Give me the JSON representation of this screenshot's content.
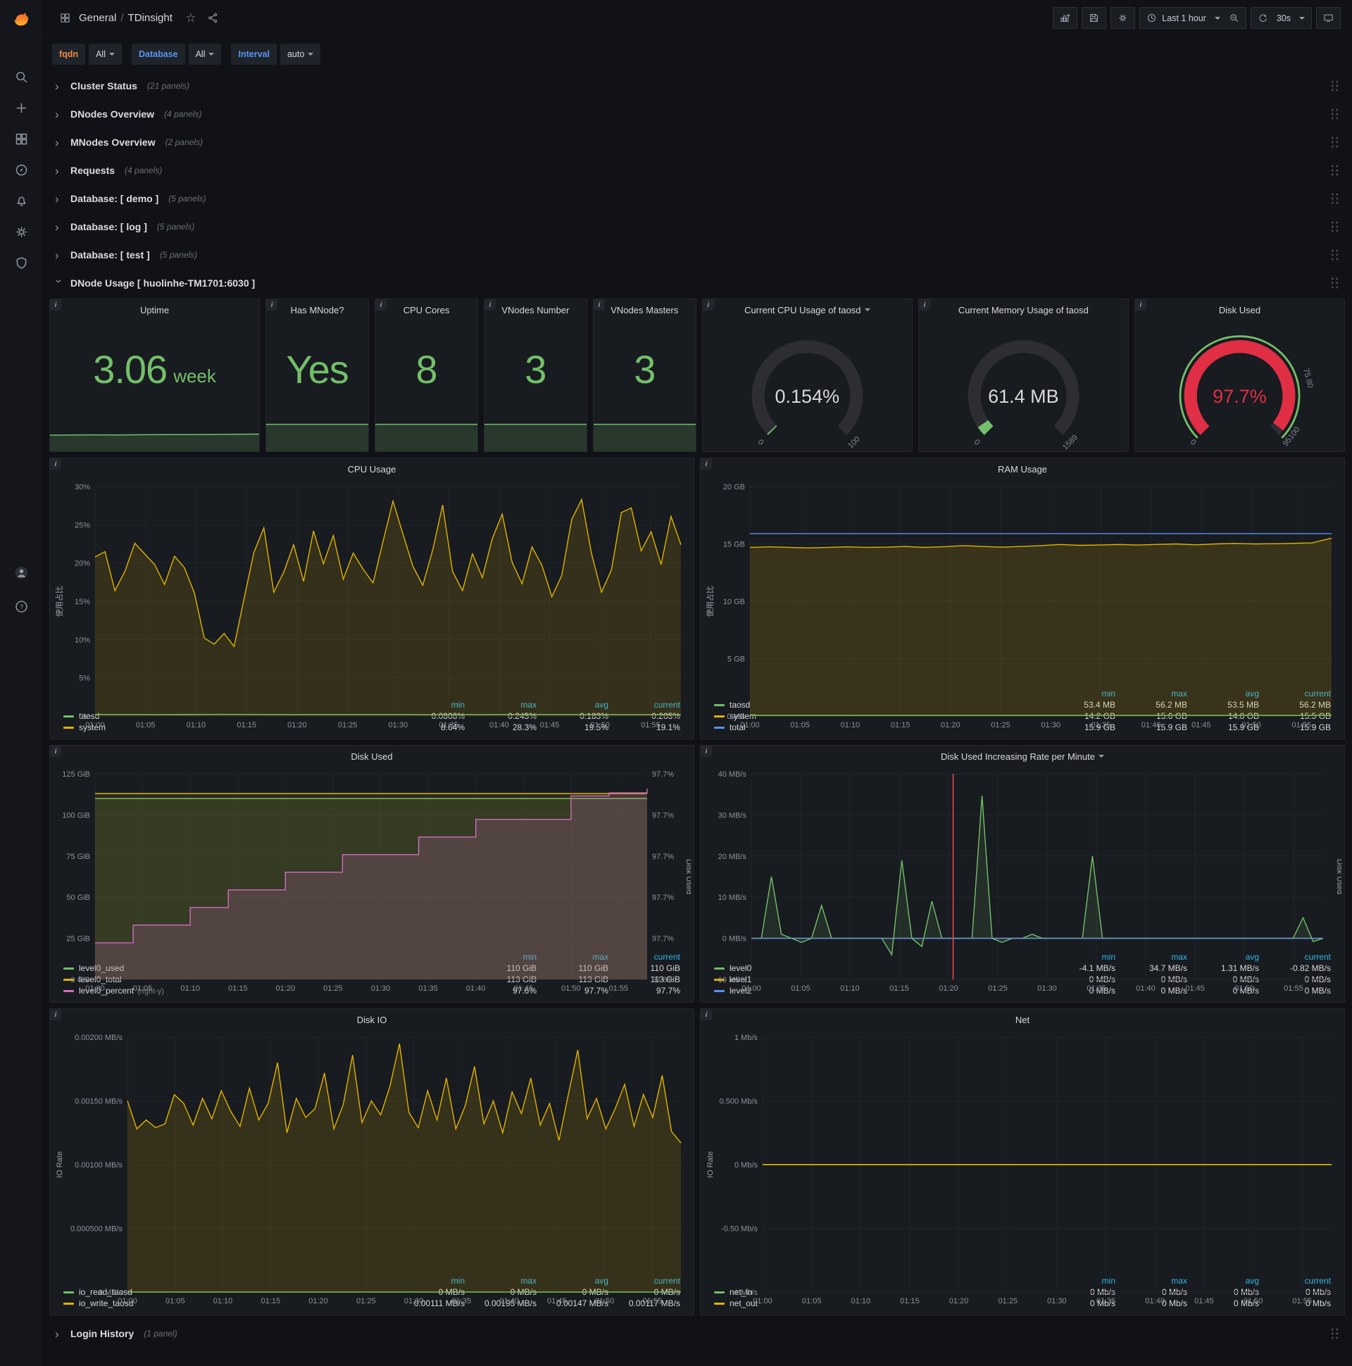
{
  "misc": {
    "info_i": "i",
    "star": "☆"
  },
  "colors": {
    "green": "#73bf69",
    "yellow": "#e0b400",
    "blue": "#5794f2",
    "pink": "#d16dc1",
    "red": "#e02f44",
    "annotation": "#f2495c"
  },
  "navbar": {
    "breadcrumb": {
      "section": "General",
      "separator": "/",
      "page": "TDinsight"
    },
    "time_range_label": "Last 1 hour",
    "refresh_value": "30s"
  },
  "variables": [
    {
      "label": "fqdn",
      "label_color": "#eb8b47",
      "value": "All"
    },
    {
      "label": "Database",
      "label_color": "#5794f2",
      "value": "All"
    },
    {
      "label": "Interval",
      "label_color": "#5794f2",
      "value": "auto"
    }
  ],
  "rows_top": [
    {
      "title": "Cluster Status",
      "count": "(21 panels)"
    },
    {
      "title": "DNodes Overview",
      "count": "(4 panels)"
    },
    {
      "title": "MNodes Overview",
      "count": "(2 panels)"
    },
    {
      "title": "Requests",
      "count": "(4 panels)"
    },
    {
      "title": "Database: [ demo ]",
      "count": "(5 panels)"
    },
    {
      "title": "Database: [ log ]",
      "count": "(5 panels)"
    },
    {
      "title": "Database: [ test ]",
      "count": "(5 panels)"
    }
  ],
  "expanded_row_title": "DNode Usage [ huolinhe-TM1701:6030 ]",
  "rows_bottom": [
    {
      "title": "Login History",
      "count": "(1 panel)"
    }
  ],
  "stat_panels": [
    {
      "title": "Uptime",
      "value": "3.06",
      "suffix": "week",
      "spark": [
        2.88,
        2.9,
        2.93,
        2.9,
        2.95,
        2.98,
        2.97,
        3.0,
        3.03,
        3.06
      ],
      "spark_max": 6.0
    },
    {
      "title": "Has MNode?",
      "value": "Yes",
      "spark": [
        1,
        1
      ],
      "spark_max": 1.25
    },
    {
      "title": "CPU Cores",
      "value": "8",
      "spark": [
        8,
        8
      ],
      "spark_max": 10
    },
    {
      "title": "VNodes Number",
      "value": "3",
      "spark": [
        3,
        3
      ],
      "spark_max": 3.75
    },
    {
      "title": "VNodes Masters",
      "value": "3",
      "spark": [
        3,
        3
      ],
      "spark_max": 3.75
    }
  ],
  "gauge_panels": [
    {
      "title": "Current CPU Usage of taosd",
      "has_caret": true,
      "value": "0.154%",
      "pct": 0.154,
      "value_color": "#d8d9da",
      "arc_color": "green",
      "ticks": [
        {
          "t": "0",
          "f": 0
        },
        {
          "t": "100",
          "f": 1
        }
      ]
    },
    {
      "title": "Current Memory Usage of taosd",
      "value": "61.4 MB",
      "pct": 3.86,
      "value_color": "#d8d9da",
      "arc_color": "green",
      "ticks": [
        {
          "t": "0",
          "f": 0
        },
        {
          "t": "1589",
          "f": 1
        }
      ]
    },
    {
      "title": "Disk Used",
      "value": "97.7%",
      "pct": 97.7,
      "value_color": "#e02f44",
      "arc_color": "red",
      "outer_ring": "#73bf69",
      "ticks": [
        {
          "t": "0",
          "f": 0
        },
        {
          "t": "75.80",
          "f": 0.78
        },
        {
          "t": "95100",
          "f": 0.975
        }
      ]
    }
  ],
  "time_ticks": [
    "01:00",
    "01:05",
    "01:10",
    "01:15",
    "01:20",
    "01:25",
    "01:30",
    "01:35",
    "01:40",
    "01:45",
    "01:50",
    "01:55"
  ],
  "charts": {
    "cpu": {
      "title": "CPU Usage",
      "type": "line",
      "ylabel": "使用占比",
      "mleft": 40,
      "yticks": [
        "30%",
        "25%",
        "20%",
        "15%",
        "10%",
        "5%",
        "0%"
      ],
      "ylim": [
        0,
        30
      ],
      "legend_cols": [
        "min",
        "max",
        "avg",
        "current"
      ],
      "series": [
        {
          "name": "taosd",
          "color": "green",
          "fill": 0.05,
          "points": [
            0.21,
            0.2,
            0.22,
            0.2,
            0.21,
            0.2,
            0.2,
            0.21,
            0.2,
            0.2
          ],
          "legend": [
            "0.0808%",
            "0.245%",
            "0.183%",
            "0.205%"
          ]
        },
        {
          "name": "system",
          "color": "yellow",
          "fill": 0.14,
          "points": [
            20.8,
            21.5,
            16.4,
            18.9,
            22.6,
            21.2,
            19.8,
            17.2,
            20.9,
            19.4,
            16.1,
            10.2,
            9.4,
            10.8,
            9.1,
            15.3,
            21.4,
            24.6,
            16.2,
            18.8,
            22.4,
            17.6,
            24.2,
            19.9,
            23.6,
            17.9,
            21.3,
            19.2,
            17.4,
            22.8,
            28.1,
            23.8,
            19.6,
            17.1,
            21.7,
            27.6,
            18.9,
            16.4,
            21.2,
            18.1,
            23.2,
            26.4,
            20.1,
            17.3,
            22.1,
            19.7,
            15.6,
            18.4,
            25.7,
            28.3,
            21.2,
            16.2,
            19.1,
            26.6,
            27.2,
            21.6,
            24.1,
            19.8,
            26.1,
            22.4
          ],
          "legend": [
            "8.64%",
            "28.3%",
            "19.5%",
            "19.1%"
          ]
        }
      ]
    },
    "ram": {
      "title": "RAM Usage",
      "type": "line",
      "ylabel": "使用占比",
      "mleft": 46,
      "yticks": [
        "20 GB",
        "15 GB",
        "10 GB",
        "5 GB",
        "0 MB"
      ],
      "ylim": [
        0,
        20
      ],
      "legend_cols": [
        "min",
        "max",
        "avg",
        "current"
      ],
      "series": [
        {
          "name": "taosd",
          "color": "green",
          "fill": 0.05,
          "points": [
            0.06,
            0.06
          ],
          "legend": [
            "53.4 MB",
            "56.2 MB",
            "53.5 MB",
            "56.2 MB"
          ]
        },
        {
          "name": "system",
          "color": "yellow",
          "fill": 0.16,
          "points": [
            14.7,
            14.75,
            14.7,
            14.65,
            14.7,
            14.75,
            14.7,
            14.72,
            14.78,
            14.7,
            14.76,
            14.85,
            14.78,
            14.72,
            14.78,
            14.85,
            14.95,
            14.88,
            14.9,
            14.95,
            14.9,
            14.96,
            15.0,
            14.92,
            15.0,
            15.05,
            15.0,
            15.02,
            15.05,
            15.1,
            15.5
          ],
          "legend": [
            "14.2 GB",
            "15.6 GB",
            "14.8 GB",
            "15.5 GB"
          ]
        },
        {
          "name": "total",
          "color": "blue",
          "fill": 0,
          "points": [
            15.9,
            15.9
          ],
          "legend": [
            "15.9 GB",
            "15.9 GB",
            "15.9 GB",
            "15.9 GB"
          ]
        }
      ]
    },
    "disk_used": {
      "title": "Disk Used",
      "type": "line",
      "mleft": 52,
      "mright": 62,
      "y2label": "Disk Used",
      "yticks": [
        "125 GiB",
        "100 GiB",
        "75 GiB",
        "50 GiB",
        "25 GiB",
        "0 GiB"
      ],
      "ylim": [
        0,
        125
      ],
      "y2ticks": [
        "97.7%",
        "97.7%",
        "97.7%",
        "97.7%",
        "97.7%",
        "97.6%"
      ],
      "ylim2": [
        97.575,
        97.715
      ],
      "legend_cols": [
        "min",
        "max",
        "current"
      ],
      "series": [
        {
          "name": "level0_used",
          "color": "green",
          "fill": 0.12,
          "points": [
            110,
            110
          ],
          "legend": [
            "110 GiB",
            "110 GiB",
            "110 GiB"
          ]
        },
        {
          "name": "level0_total",
          "color": "yellow",
          "fill": 0.1,
          "points": [
            113,
            113
          ],
          "legend": [
            "113 GiB",
            "113 GiB",
            "113 GiB"
          ]
        },
        {
          "name": "level0_percent",
          "suffix": "(right-y)",
          "color": "pink",
          "fill": 0.18,
          "axis2": true,
          "step": true,
          "points": [
            97.6,
            97.6,
            97.612,
            97.612,
            97.612,
            97.624,
            97.624,
            97.636,
            97.636,
            97.636,
            97.648,
            97.648,
            97.648,
            97.66,
            97.66,
            97.66,
            97.66,
            97.672,
            97.672,
            97.672,
            97.684,
            97.684,
            97.684,
            97.684,
            97.684,
            97.7,
            97.7,
            97.702,
            97.702,
            97.705
          ],
          "legend": [
            "97.6%",
            "97.7%",
            "97.7%"
          ]
        }
      ]
    },
    "disk_rate": {
      "title": "Disk Used Increasing Rate per Minute",
      "type": "line",
      "has_caret": true,
      "mleft": 60,
      "mright": 26,
      "y2label": "Disk Used",
      "yticks": [
        "40 MB/s",
        "30 MB/s",
        "20 MB/s",
        "10 MB/s",
        "0 MB/s",
        "-10 MB/s"
      ],
      "ylim": [
        -10,
        40
      ],
      "legend_cols": [
        "min",
        "max",
        "avg",
        "current"
      ],
      "annotation": {
        "frac": 0.353,
        "color": "#f2495c"
      },
      "series": [
        {
          "name": "level0",
          "color": "green",
          "fill": 0.12,
          "points": [
            0,
            0,
            15,
            1,
            0,
            -1,
            0,
            8,
            0,
            0,
            0,
            0,
            0,
            0,
            -4,
            19,
            0,
            -2,
            9,
            0,
            0,
            0,
            0,
            34.7,
            0,
            -1,
            0,
            0,
            1,
            0,
            0,
            0,
            0,
            0,
            20,
            0,
            0,
            0,
            0,
            0,
            0,
            0,
            0,
            0,
            0,
            0,
            0,
            0,
            0,
            0,
            0,
            0,
            0,
            0,
            0,
            5,
            -0.8,
            0
          ],
          "legend": [
            "-4.1 MB/s",
            "34.7 MB/s",
            "1.31 MB/s",
            "-0.82 MB/s"
          ]
        },
        {
          "name": "level1",
          "color": "yellow",
          "fill": 0,
          "points": [
            0,
            0
          ],
          "legend": [
            "0 MB/s",
            "0 MB/s",
            "0 MB/s",
            "0 MB/s"
          ]
        },
        {
          "name": "level2",
          "color": "blue",
          "fill": 0,
          "points": [
            0,
            0
          ],
          "legend": [
            "0 MB/s",
            "0 MB/s",
            "0 MB/s",
            "0 MB/s"
          ]
        }
      ]
    },
    "disk_io": {
      "title": "Disk IO",
      "type": "line",
      "ylabel": "IO Rate",
      "mleft": 86,
      "yticks": [
        "0.00200 MB/s",
        "0.00150 MB/s",
        "0.00100 MB/s",
        "0.000500 MB/s",
        "0 MB/s"
      ],
      "ylim": [
        0,
        0.002
      ],
      "legend_cols": [
        "min",
        "max",
        "avg",
        "current"
      ],
      "series": [
        {
          "name": "io_read_taosd",
          "color": "green",
          "fill": 0,
          "points": [
            0,
            0
          ],
          "legend": [
            "0 MB/s",
            "0 MB/s",
            "0 MB/s",
            "0 MB/s"
          ]
        },
        {
          "name": "io_write_taosd",
          "color": "yellow",
          "fill": 0.15,
          "points": [
            0.0015,
            0.00128,
            0.00135,
            0.00129,
            0.00132,
            0.00155,
            0.00148,
            0.00131,
            0.00152,
            0.00136,
            0.00158,
            0.00142,
            0.0013,
            0.0016,
            0.00135,
            0.00148,
            0.0018,
            0.00125,
            0.00152,
            0.00137,
            0.00144,
            0.00172,
            0.00128,
            0.00147,
            0.00186,
            0.00133,
            0.0015,
            0.00139,
            0.00162,
            0.00195,
            0.00141,
            0.00129,
            0.00158,
            0.00135,
            0.00168,
            0.00128,
            0.00146,
            0.00177,
            0.00132,
            0.0015,
            0.00125,
            0.00157,
            0.0014,
            0.00168,
            0.00131,
            0.00148,
            0.00119,
            0.00155,
            0.0019,
            0.00136,
            0.00152,
            0.00128,
            0.00144,
            0.00163,
            0.0013,
            0.00155,
            0.00137,
            0.0017,
            0.00126,
            0.00117
          ],
          "legend": [
            "0.00111 MB/s",
            "0.00195 MB/s",
            "0.00147 MB/s",
            "0.00117 MB/s"
          ]
        }
      ]
    },
    "net": {
      "title": "Net",
      "type": "line",
      "ylabel": "IO Rate",
      "mleft": 64,
      "yticks": [
        "1 Mb/s",
        "0.500 Mb/s",
        "0 Mb/s",
        "-0.50 Mb/s",
        "-1 Mb/s"
      ],
      "ylim": [
        -1,
        1
      ],
      "legend_cols": [
        "min",
        "max",
        "avg",
        "current"
      ],
      "series": [
        {
          "name": "net_in",
          "color": "green",
          "fill": 0,
          "points": [
            0,
            0
          ],
          "legend": [
            "0 Mb/s",
            "0 Mb/s",
            "0 Mb/s",
            "0 Mb/s"
          ]
        },
        {
          "name": "net_out",
          "color": "yellow",
          "fill": 0,
          "points": [
            0,
            0
          ],
          "legend": [
            "0 Mb/s",
            "0 Mb/s",
            "0 Mb/s",
            "0 Mb/s"
          ]
        }
      ]
    }
  }
}
